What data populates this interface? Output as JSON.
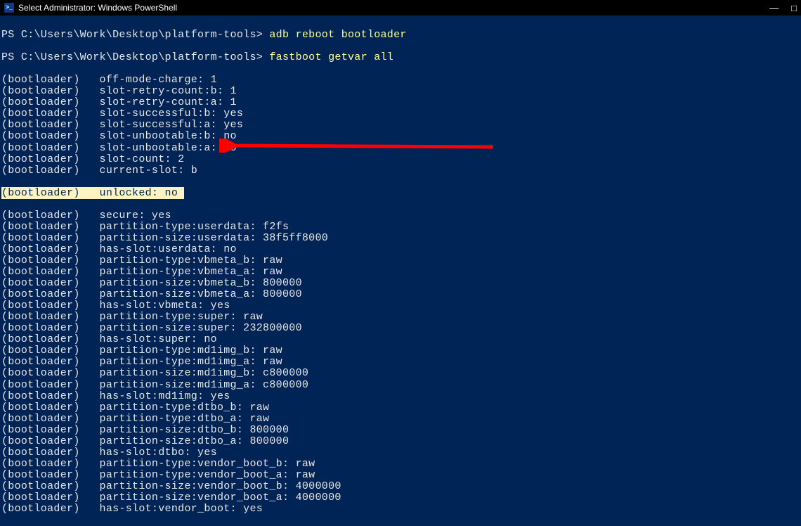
{
  "titlebar": {
    "icon_label": ">_",
    "title": "Select Administrator: Windows PowerShell"
  },
  "prompts": {
    "p1_prefix": "PS C:\\Users\\Work\\Desktop\\platform-tools> ",
    "p1_cmd": "adb reboot bootloader",
    "p2_prefix": "PS C:\\Users\\Work\\Desktop\\platform-tools> ",
    "p2_cmd": "fastboot getvar all"
  },
  "highlight_line": "(bootloader)   unlocked: no ",
  "lines_before": [
    "(bootloader)   off-mode-charge: 1",
    "(bootloader)   slot-retry-count:b: 1",
    "(bootloader)   slot-retry-count:a: 1",
    "(bootloader)   slot-successful:b: yes",
    "(bootloader)   slot-successful:a: yes",
    "(bootloader)   slot-unbootable:b: no",
    "(bootloader)   slot-unbootable:a: no",
    "(bootloader)   slot-count: 2",
    "(bootloader)   current-slot: b"
  ],
  "lines_after": [
    "(bootloader)   secure: yes",
    "(bootloader)   partition-type:userdata: f2fs",
    "(bootloader)   partition-size:userdata: 38f5ff8000",
    "(bootloader)   has-slot:userdata: no",
    "(bootloader)   partition-type:vbmeta_b: raw",
    "(bootloader)   partition-type:vbmeta_a: raw",
    "(bootloader)   partition-size:vbmeta_b: 800000",
    "(bootloader)   partition-size:vbmeta_a: 800000",
    "(bootloader)   has-slot:vbmeta: yes",
    "(bootloader)   partition-type:super: raw",
    "(bootloader)   partition-size:super: 232800000",
    "(bootloader)   has-slot:super: no",
    "(bootloader)   partition-type:md1img_b: raw",
    "(bootloader)   partition-type:md1img_a: raw",
    "(bootloader)   partition-size:md1img_b: c800000",
    "(bootloader)   partition-size:md1img_a: c800000",
    "(bootloader)   has-slot:md1img: yes",
    "(bootloader)   partition-type:dtbo_b: raw",
    "(bootloader)   partition-type:dtbo_a: raw",
    "(bootloader)   partition-size:dtbo_b: 800000",
    "(bootloader)   partition-size:dtbo_a: 800000",
    "(bootloader)   has-slot:dtbo: yes",
    "(bootloader)   partition-type:vendor_boot_b: raw",
    "(bootloader)   partition-type:vendor_boot_a: raw",
    "(bootloader)   partition-size:vendor_boot_b: 4000000",
    "(bootloader)   partition-size:vendor_boot_a: 4000000",
    "(bootloader)   has-slot:vendor_boot: yes"
  ]
}
